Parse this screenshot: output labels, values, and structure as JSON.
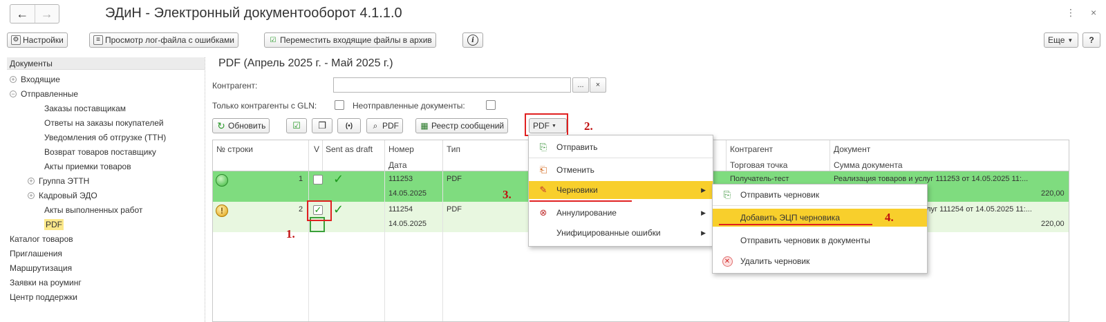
{
  "window": {
    "back_icon": "←",
    "forward_icon": "→",
    "title": "ЭДиН - Электронный документооборот 4.1.1.0",
    "more_icon": "⋮",
    "close_icon": "×"
  },
  "toolbar": {
    "settings_label": "Настройки",
    "view_log_label": "Просмотр лог-файла с ошибками",
    "move_files_label": "Переместить входящие файлы в архив",
    "info_label": "i",
    "more_label": "Еще",
    "help_label": "?"
  },
  "sidebar": {
    "header": "Документы",
    "items": [
      {
        "label": "Входящие",
        "toggle": "+"
      },
      {
        "label": "Отправленные",
        "toggle": "−"
      },
      {
        "label": "Заказы поставщикам"
      },
      {
        "label": "Ответы на заказы покупателей"
      },
      {
        "label": "Уведомления об отгрузке (ТТН)"
      },
      {
        "label": "Возврат товаров поставщику"
      },
      {
        "label": "Акты приемки товаров"
      },
      {
        "label": "Группа ЭТТН",
        "toggle": "+"
      },
      {
        "label": "Кадровый ЭДО",
        "toggle": "+"
      },
      {
        "label": "Акты выполненных работ"
      },
      {
        "label": "PDF"
      },
      {
        "label": "Каталог товаров"
      },
      {
        "label": "Приглашения"
      },
      {
        "label": "Маршрутизация"
      },
      {
        "label": "Заявки на роуминг"
      },
      {
        "label": "Центр поддержки"
      }
    ]
  },
  "main": {
    "title": "PDF (Апрель 2025 г. - Май 2025 г.)",
    "contractor_label": "Контрагент:",
    "contractor_value": "",
    "contractor_select": "...",
    "contractor_clear": "×",
    "gln_label": "Только контрагенты с GLN:",
    "unsent_label": "Неотправленные документы:",
    "refresh_label": "Обновить",
    "pdf_button_label": "PDF",
    "registry_label": "Реестр сообщений",
    "pdf_dropdown_label": "PDF"
  },
  "table": {
    "headers": {
      "row_no": "№ строки",
      "v": "V",
      "sent_as_draft": "Sent as draft",
      "number": "Номер",
      "date": "Дата",
      "type": "Тип",
      "contractor": "Контрагент",
      "trade_point": "Торговая точка",
      "document": "Документ",
      "doc_sum": "Сумма документа"
    },
    "rows": [
      {
        "row_no": "1",
        "number": "111253",
        "date": "14.05.2025",
        "type": "PDF",
        "contractor": "Получатель-тест",
        "document": "Реализация товаров и услуг 111253 от 14.05.2025 11:...",
        "sum": "220,00"
      },
      {
        "row_no": "2",
        "number": "111254",
        "date": "14.05.2025",
        "type": "PDF",
        "document": "и услуг 111254 от 14.05.2025 11:...",
        "sum": "220,00"
      }
    ]
  },
  "menu_pdf": {
    "items": [
      {
        "label": "Отправить",
        "icon": "send-icon"
      },
      {
        "label": "Отменить",
        "icon": "cancel-icon"
      },
      {
        "label": "Черновики",
        "icon": "drafts-icon"
      },
      {
        "label": "Аннулирование",
        "icon": "annul-icon"
      },
      {
        "label": "Унифицированные ошибки",
        "icon": ""
      }
    ]
  },
  "menu_drafts": {
    "items": [
      {
        "label": "Отправить черновик",
        "icon": "send-draft-icon"
      },
      {
        "label": "Добавить ЭЦП черновика",
        "icon": ""
      },
      {
        "label": "Отправить черновик в документы",
        "icon": ""
      },
      {
        "label": "Удалить черновик",
        "icon": "delete-icon"
      }
    ]
  },
  "annotations": {
    "step1": "1.",
    "step2": "2.",
    "step3": "3.",
    "step4": "4."
  },
  "colors": {
    "row_green": "#7fdc7f",
    "row_light_green": "#e8f7e0",
    "highlight_yellow": "#f8cf2c",
    "annotation_red": "#e02020",
    "selected_tree": "#fbe88a"
  }
}
